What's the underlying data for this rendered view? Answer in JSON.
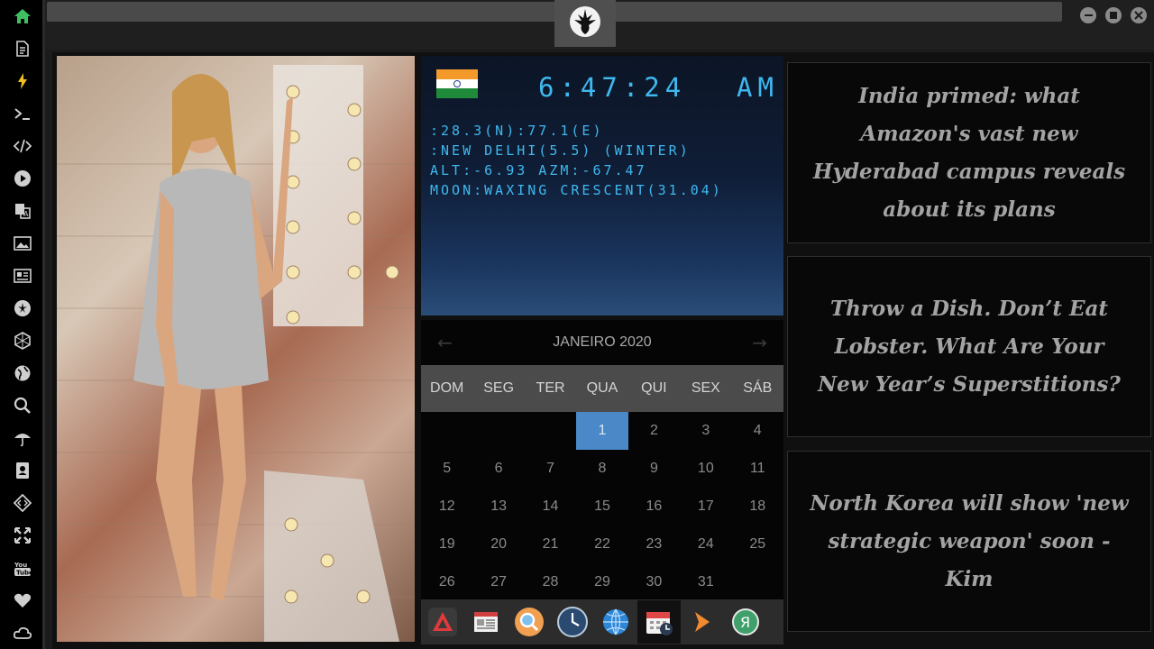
{
  "sidebar": {
    "items": [
      {
        "icon": "home-icon",
        "color": "#3fbf5f"
      },
      {
        "icon": "document-icon",
        "color": "#cfcfcf"
      },
      {
        "icon": "lightning-icon",
        "color": "#f0c020"
      },
      {
        "icon": "terminal-icon",
        "color": "#cfcfcf"
      },
      {
        "icon": "code-icon",
        "color": "#cfcfcf"
      },
      {
        "icon": "play-icon",
        "color": "#cfcfcf"
      },
      {
        "icon": "translate-icon",
        "color": "#cfcfcf"
      },
      {
        "icon": "image-icon",
        "color": "#cfcfcf"
      },
      {
        "icon": "news-icon",
        "color": "#cfcfcf"
      },
      {
        "icon": "rebel-icon",
        "color": "#cfcfcf"
      },
      {
        "icon": "hexagon-icon",
        "color": "#cfcfcf"
      },
      {
        "icon": "globe-icon",
        "color": "#cfcfcf"
      },
      {
        "icon": "search-icon",
        "color": "#cfcfcf"
      },
      {
        "icon": "umbrella-icon",
        "color": "#cfcfcf"
      },
      {
        "icon": "contact-icon",
        "color": "#cfcfcf"
      },
      {
        "icon": "diamond-code-icon",
        "color": "#cfcfcf"
      },
      {
        "icon": "expand-icon",
        "color": "#cfcfcf"
      },
      {
        "icon": "youtube-icon",
        "color": "#cfcfcf"
      },
      {
        "icon": "heart-icon",
        "color": "#cfcfcf"
      },
      {
        "icon": "cloud-icon",
        "color": "#cfcfcf"
      }
    ]
  },
  "clock": {
    "flag": "india-flag-icon",
    "time": "6:47:24",
    "ampm": "AM",
    "coords": ":28.3(N):77.1(E)",
    "location": ":NEW DELHI(5.5) (WINTER)",
    "altaz": "ALT:-6.93 AZM:-67.47",
    "moon": "MOON:WAXING CRESCENT(31.04)",
    "color": "#3fb8ee"
  },
  "calendar": {
    "month": "JANEIRO 2020",
    "weekdays": [
      "DOM",
      "SEG",
      "TER",
      "QUA",
      "QUI",
      "SEX",
      "SÁB"
    ],
    "rows": [
      [
        "",
        "",
        "",
        "1",
        "2",
        "3",
        "4"
      ],
      [
        "5",
        "6",
        "7",
        "8",
        "9",
        "10",
        "11"
      ],
      [
        "12",
        "13",
        "14",
        "15",
        "16",
        "17",
        "18"
      ],
      [
        "19",
        "20",
        "21",
        "22",
        "23",
        "24",
        "25"
      ],
      [
        "26",
        "27",
        "28",
        "29",
        "30",
        "31",
        ""
      ]
    ],
    "selected": "1",
    "accent": "#4a88c7"
  },
  "dock": [
    {
      "icon": "launcher-icon"
    },
    {
      "icon": "newspaper-app-icon"
    },
    {
      "icon": "search-app-icon"
    },
    {
      "icon": "clock-app-icon"
    },
    {
      "icon": "browser-globe-icon"
    },
    {
      "icon": "calendar-app-icon",
      "active": true
    },
    {
      "icon": "forward-arrow-icon"
    },
    {
      "icon": "yandex-icon"
    }
  ],
  "news": [
    {
      "headline": "India primed: what Amazon's vast new Hyderabad campus reveals about its plans"
    },
    {
      "headline": "Throw a Dish. Don’t Eat Lobster. What Are Your New Year’s Superstitions?"
    },
    {
      "headline": "North Korea will show 'new strategic weapon' soon - Kim"
    }
  ]
}
